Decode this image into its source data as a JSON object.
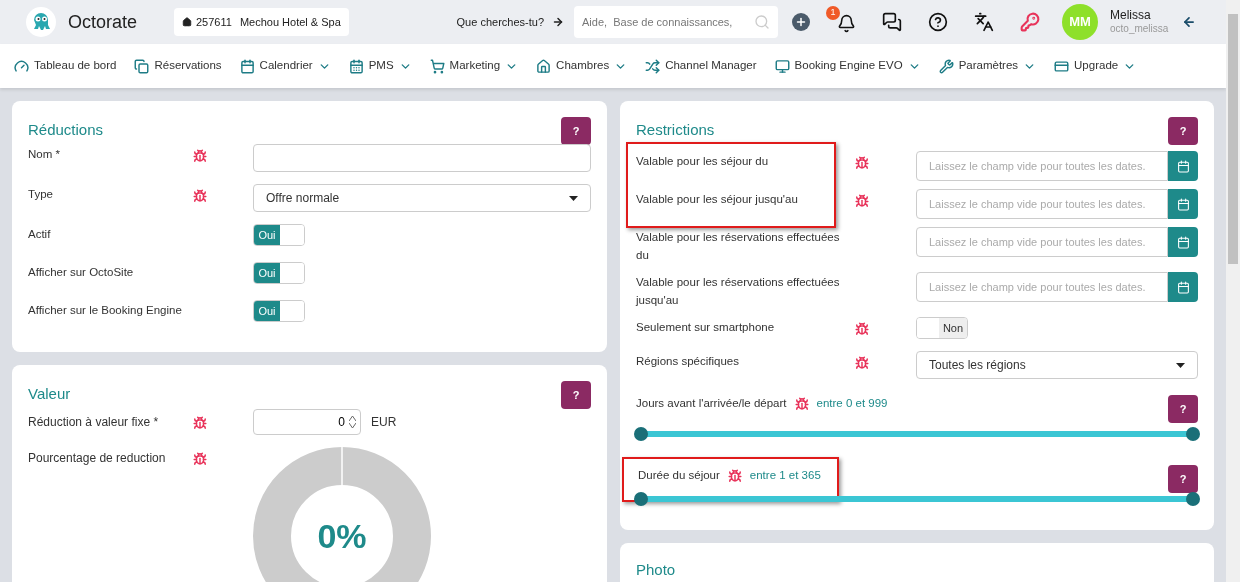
{
  "header": {
    "brand": "Octorate",
    "property": {
      "id": "257611",
      "name": "Mechou Hotel & Spa"
    },
    "search_prompt": "Que cherches-tu?",
    "search": {
      "placeholder": "Aide,  Base de connaissances,"
    },
    "notification_count": "1",
    "user": {
      "initials": "MM",
      "name": "Melissa",
      "username": "octo_melissa"
    }
  },
  "nav": [
    {
      "label": "Tableau de bord",
      "dropdown": false
    },
    {
      "label": "Réservations",
      "dropdown": false
    },
    {
      "label": "Calendrier",
      "dropdown": true
    },
    {
      "label": "PMS",
      "dropdown": true
    },
    {
      "label": "Marketing",
      "dropdown": true
    },
    {
      "label": "Chambres",
      "dropdown": true
    },
    {
      "label": "Channel Manager",
      "dropdown": false
    },
    {
      "label": "Booking Engine EVO",
      "dropdown": true
    },
    {
      "label": "Paramètres",
      "dropdown": true
    },
    {
      "label": "Upgrade",
      "dropdown": true
    }
  ],
  "reductions": {
    "title": "Réductions",
    "help": "?",
    "rows": [
      {
        "kind": "text",
        "label": "Nom  *",
        "bug": true,
        "value": ""
      },
      {
        "kind": "select",
        "label": "Type",
        "bug": true,
        "value": "Offre normale"
      },
      {
        "kind": "toggle",
        "label": "Actif",
        "bug": false,
        "on": true,
        "text": "Oui"
      },
      {
        "kind": "toggle",
        "label": "Afficher sur OctoSite",
        "bug": false,
        "on": true,
        "text": "Oui"
      },
      {
        "kind": "toggle",
        "label": "Afficher sur le Booking Engine",
        "bug": false,
        "on": true,
        "text": "Oui"
      }
    ]
  },
  "valeur": {
    "title": "Valeur",
    "help": "?",
    "fixed": {
      "label": "Réduction à valeur fixe  *",
      "bug": true,
      "value": "0",
      "unit": "EUR"
    },
    "percent": {
      "label": "Pourcentage de reduction",
      "bug": true,
      "text": "0%"
    }
  },
  "restrictions": {
    "title": "Restrictions",
    "help": "?",
    "groups": [
      {
        "highlighted": true,
        "rows": [
          {
            "kind": "date",
            "label": "Valable pour les séjour du",
            "bug": true,
            "placeholder": "Laissez le champ vide pour toutes les dates."
          },
          {
            "kind": "date",
            "label": "Valable pour les séjour jusqu'au",
            "bug": true,
            "placeholder": "Laissez le champ vide pour toutes les dates."
          }
        ]
      },
      {
        "highlighted": false,
        "rows": [
          {
            "kind": "date",
            "label": "Valable pour les réservations effectuées du",
            "bug": false,
            "placeholder": "Laissez le champ vide pour toutes les dates."
          },
          {
            "kind": "date",
            "label": "Valable pour les réservations effectuées jusqu'au",
            "bug": false,
            "placeholder": "Laissez le champ vide pour toutes les dates."
          },
          {
            "kind": "toggle",
            "label": "Seulement sur smartphone",
            "bug": true,
            "on": false,
            "text": "Non"
          },
          {
            "kind": "select",
            "label": "Régions spécifiques",
            "bug": true,
            "value": "Toutes les régions"
          }
        ]
      }
    ],
    "sliders": [
      {
        "label": "Jours avant l'arrivée/le départ",
        "bug": true,
        "range": "entre 0 et 999",
        "help": "?",
        "highlighted": false,
        "thumbs": [
          {
            "level": 0
          },
          {
            "level": 1
          }
        ]
      },
      {
        "label": "Durée du séjour",
        "bug": true,
        "range": "entre 1 et 365",
        "help": "?",
        "highlighted": true,
        "thumbs": [
          {
            "level": 0
          },
          {
            "level": 1
          }
        ]
      }
    ]
  },
  "photo": {
    "title": "Photo"
  }
}
